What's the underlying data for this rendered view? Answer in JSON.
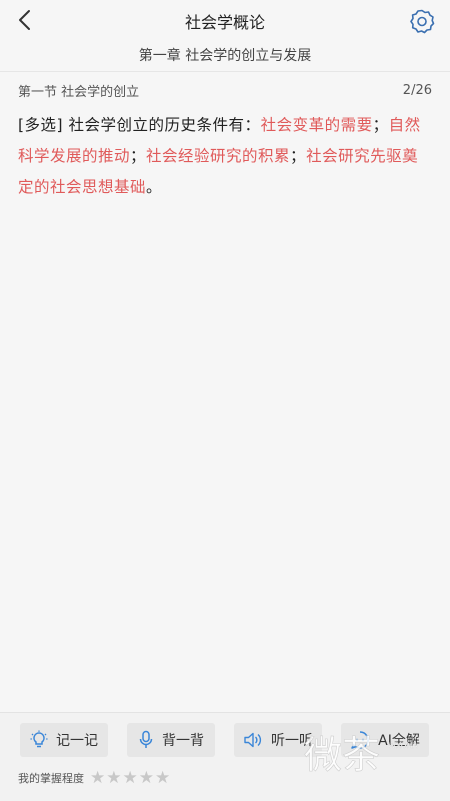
{
  "header": {
    "title": "社会学概论"
  },
  "chapter": {
    "title": "第一章 社会学的创立与发展"
  },
  "section": {
    "title": "第一节 社会学的创立",
    "progress": "2/26"
  },
  "question": {
    "type_tag": "[多选]",
    "stem": "社会学创立的历史条件有：",
    "answers": [
      "社会变革的需要",
      "自然科学发展的推动",
      "社会经验研究的积累",
      "社会研究先驱奠定的社会思想基础"
    ],
    "separator": "；",
    "end": "。"
  },
  "toolbar": {
    "buttons": [
      {
        "label": "记一记",
        "icon": "lightbulb-icon"
      },
      {
        "label": "背一背",
        "icon": "microphone-icon"
      },
      {
        "label": "听一听",
        "icon": "speaker-icon"
      },
      {
        "label": "AI全解",
        "icon": "ai-explain-icon"
      }
    ]
  },
  "mastery": {
    "label": "我的掌握程度",
    "rating": 0,
    "max": 5
  },
  "watermark": {
    "text": "微茶",
    "subtext": "WXCHA"
  },
  "colors": {
    "answer": "#e05a5a",
    "icon": "#3a86d8",
    "star_empty": "#c8c8c8"
  }
}
